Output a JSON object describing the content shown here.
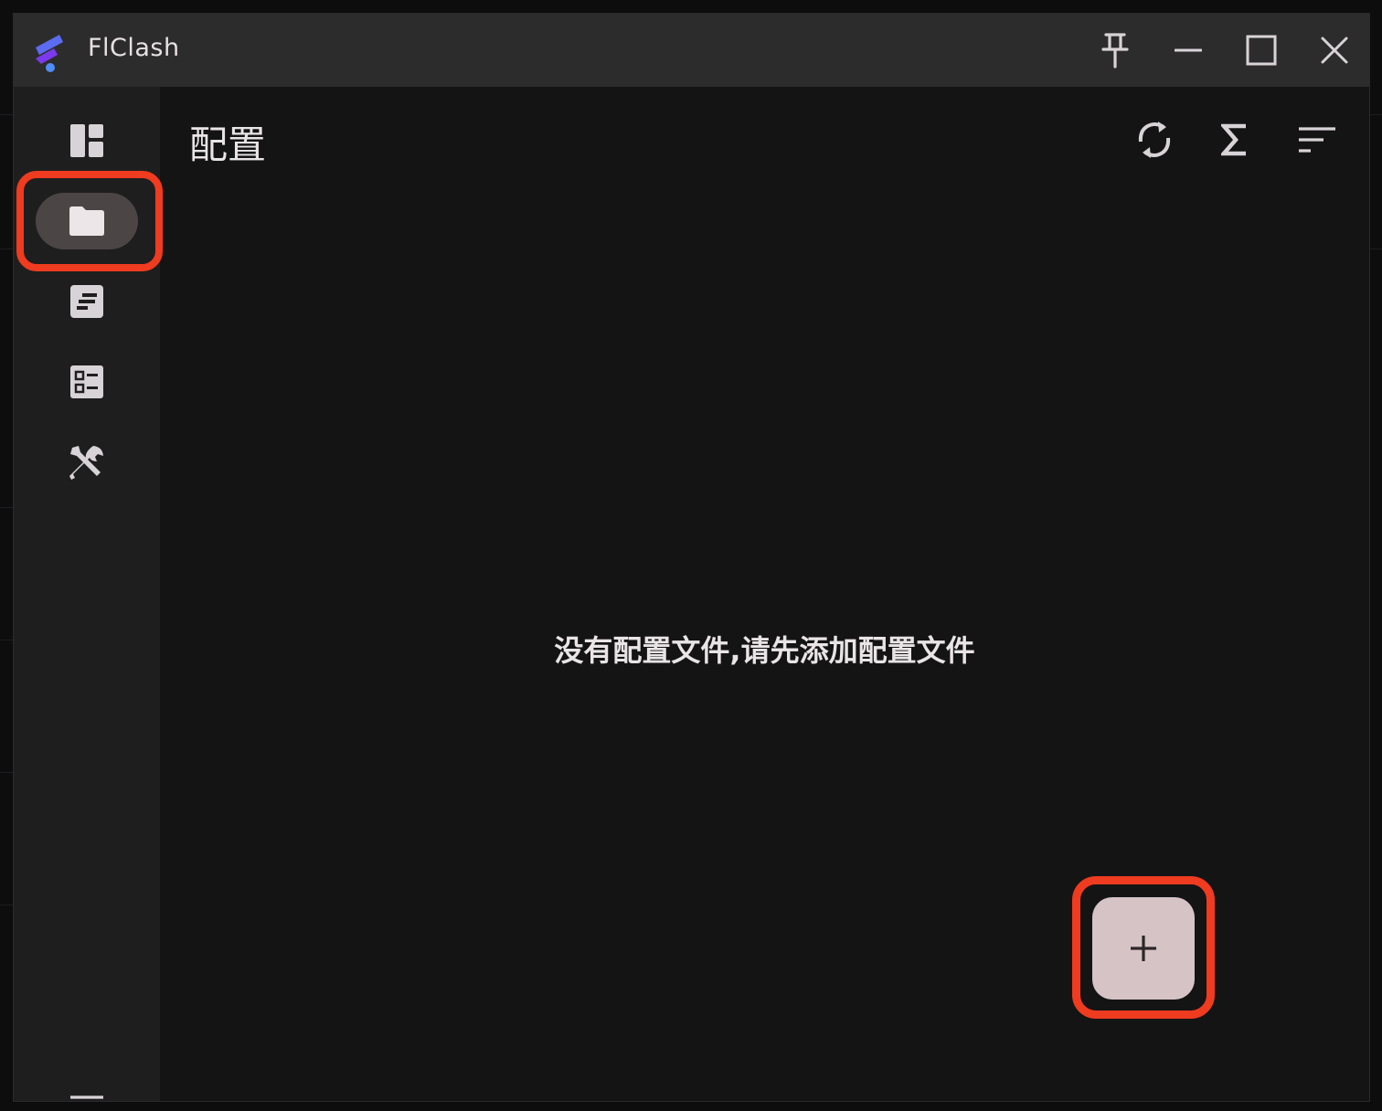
{
  "app": {
    "title": "FlClash",
    "logo_icon": "flclash-logo-icon"
  },
  "window_controls": [
    {
      "name": "pin-button",
      "icon": "pin-icon"
    },
    {
      "name": "minimize-button",
      "icon": "minimize-icon"
    },
    {
      "name": "maximize-button",
      "icon": "maximize-icon"
    },
    {
      "name": "close-button",
      "icon": "close-icon"
    }
  ],
  "sidebar": {
    "items": [
      {
        "key": "dashboard",
        "icon": "dashboard-icon",
        "active": false
      },
      {
        "key": "profiles",
        "icon": "folder-icon",
        "active": true
      },
      {
        "key": "logs",
        "icon": "article-icon",
        "active": false
      },
      {
        "key": "rules",
        "icon": "checklist-icon",
        "active": false
      },
      {
        "key": "tools",
        "icon": "tools-icon",
        "active": false
      }
    ],
    "menu_icon": "menu-icon"
  },
  "page": {
    "title": "配置",
    "empty_message": "没有配置文件,请先添加配置文件"
  },
  "toolbar": [
    {
      "name": "sync-button",
      "icon": "sync-icon"
    },
    {
      "name": "sum-button",
      "icon": "sigma-icon"
    },
    {
      "name": "sort-button",
      "icon": "sort-icon"
    }
  ],
  "fab": {
    "icon": "plus-icon",
    "label": "+"
  },
  "colors": {
    "accent_highlight": "#ef3b1f",
    "active_nav": "#4c4546",
    "fab_bg": "#d6c3c6",
    "window_bg": "#141415",
    "sidebar_bg": "#1f1e1f",
    "titlebar_bg": "#2d2c2d"
  }
}
